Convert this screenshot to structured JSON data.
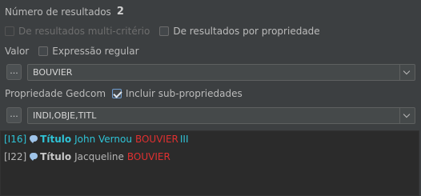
{
  "header": {
    "results_label": "Número de resultados",
    "results_count": "2"
  },
  "options": {
    "multi_criteria_label": "De resultados multi-critério",
    "by_property_label": "De resultados por propriedade"
  },
  "value_section": {
    "label": "Valor",
    "regex_label": "Expressão regular",
    "button_label": "...",
    "value": "BOUVIER"
  },
  "gedcom_section": {
    "label": "Propriedade Gedcom",
    "include_sub_label": "Incluir sub-propriedades",
    "button_label": "...",
    "value": "INDI,OBJE,TITL"
  },
  "results": [
    {
      "id": "[I16]",
      "tag": "Título",
      "name": "John Vernou",
      "match": "BOUVIER",
      "suffix": "III"
    },
    {
      "id": "[I22]",
      "tag": "Título",
      "name": "Jacqueline",
      "match": "BOUVIER",
      "suffix": ""
    }
  ],
  "colors": {
    "background": "#3c3f41",
    "accent": "#2fc3d6",
    "match": "#e03030"
  }
}
